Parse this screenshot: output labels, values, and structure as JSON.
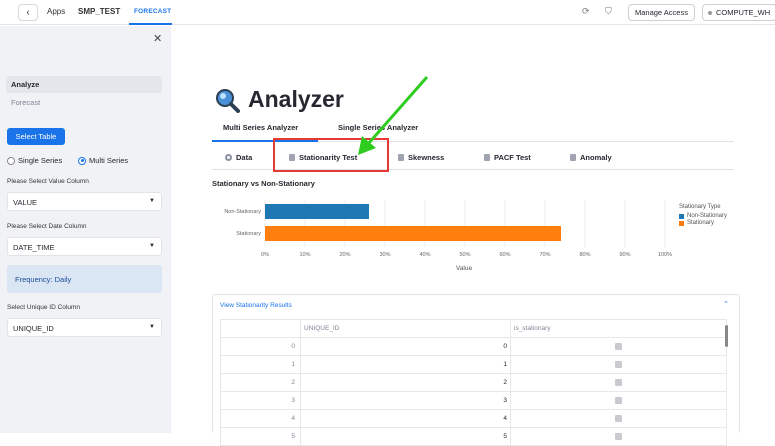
{
  "topbar": {
    "back_icon": "chevron-left-icon",
    "apps": "Apps",
    "app_name": "SMP_TEST",
    "active_tab": "FORECAST",
    "manage_access": "Manage Access",
    "warehouse": "COMPUTE_WH"
  },
  "sidebar": {
    "nav": [
      {
        "label": "Analyze",
        "active": true
      },
      {
        "label": "Forecast",
        "active": false
      }
    ],
    "select_table_label": "Select Table",
    "radio_options": [
      {
        "label": "Single Series",
        "selected": false
      },
      {
        "label": "Multi Series",
        "selected": true
      }
    ],
    "value_column_label": "Please Select Value Column",
    "value_column": "VALUE",
    "date_column_label": "Please Select Date Column",
    "date_column": "DATE_TIME",
    "frequency_info": "Frequency: Daily",
    "unique_id_label": "Select Unique ID Column",
    "unique_id": "UNIQUE_ID"
  },
  "main": {
    "title_icon": "magnifier-icon",
    "title": "Analyzer",
    "tabs": [
      {
        "label": "Multi Series Analyzer",
        "active": true
      },
      {
        "label": "Single Series Analyzer",
        "active": false
      }
    ],
    "subtabs": [
      {
        "label": "Data",
        "icon": "gear-icon"
      },
      {
        "label": "Stationarity Test",
        "icon": "doc-icon"
      },
      {
        "label": "Skewness",
        "icon": "doc-icon"
      },
      {
        "label": "PACF Test",
        "icon": "doc-icon"
      },
      {
        "label": "Anomaly",
        "icon": "doc-icon"
      }
    ]
  },
  "chart_data": {
    "type": "bar",
    "orientation": "horizontal",
    "title": "Stationary vs Non-Stationary",
    "categories": [
      "Non-Stationary",
      "Stationary"
    ],
    "series": [
      {
        "name": "Non-Stationary",
        "values": [
          26,
          null
        ],
        "color": "#1f77b4"
      },
      {
        "name": "Stationary",
        "values": [
          null,
          74
        ],
        "color": "#ff7f0e"
      }
    ],
    "xlabel": "Value",
    "ylabel": "",
    "xlim": [
      0,
      100
    ],
    "xticks": [
      "0%",
      "10%",
      "20%",
      "30%",
      "40%",
      "50%",
      "60%",
      "70%",
      "80%",
      "90%",
      "100%"
    ],
    "grid": true,
    "legend_title": "Stationary Type",
    "legend_placement": "right"
  },
  "results": {
    "header": "View Stationarity Results",
    "columns": [
      "",
      "UNIQUE_ID",
      "is_stationary"
    ],
    "rows": [
      {
        "index": "0",
        "unique_id": "0",
        "is_stationary": true
      },
      {
        "index": "1",
        "unique_id": "1",
        "is_stationary": true
      },
      {
        "index": "2",
        "unique_id": "2",
        "is_stationary": true
      },
      {
        "index": "3",
        "unique_id": "3",
        "is_stationary": true
      },
      {
        "index": "4",
        "unique_id": "4",
        "is_stationary": true
      },
      {
        "index": "5",
        "unique_id": "5",
        "is_stationary": true
      }
    ]
  },
  "annotation": {
    "arrow_color": "#2ecc1f",
    "box_color": "#e53935"
  }
}
